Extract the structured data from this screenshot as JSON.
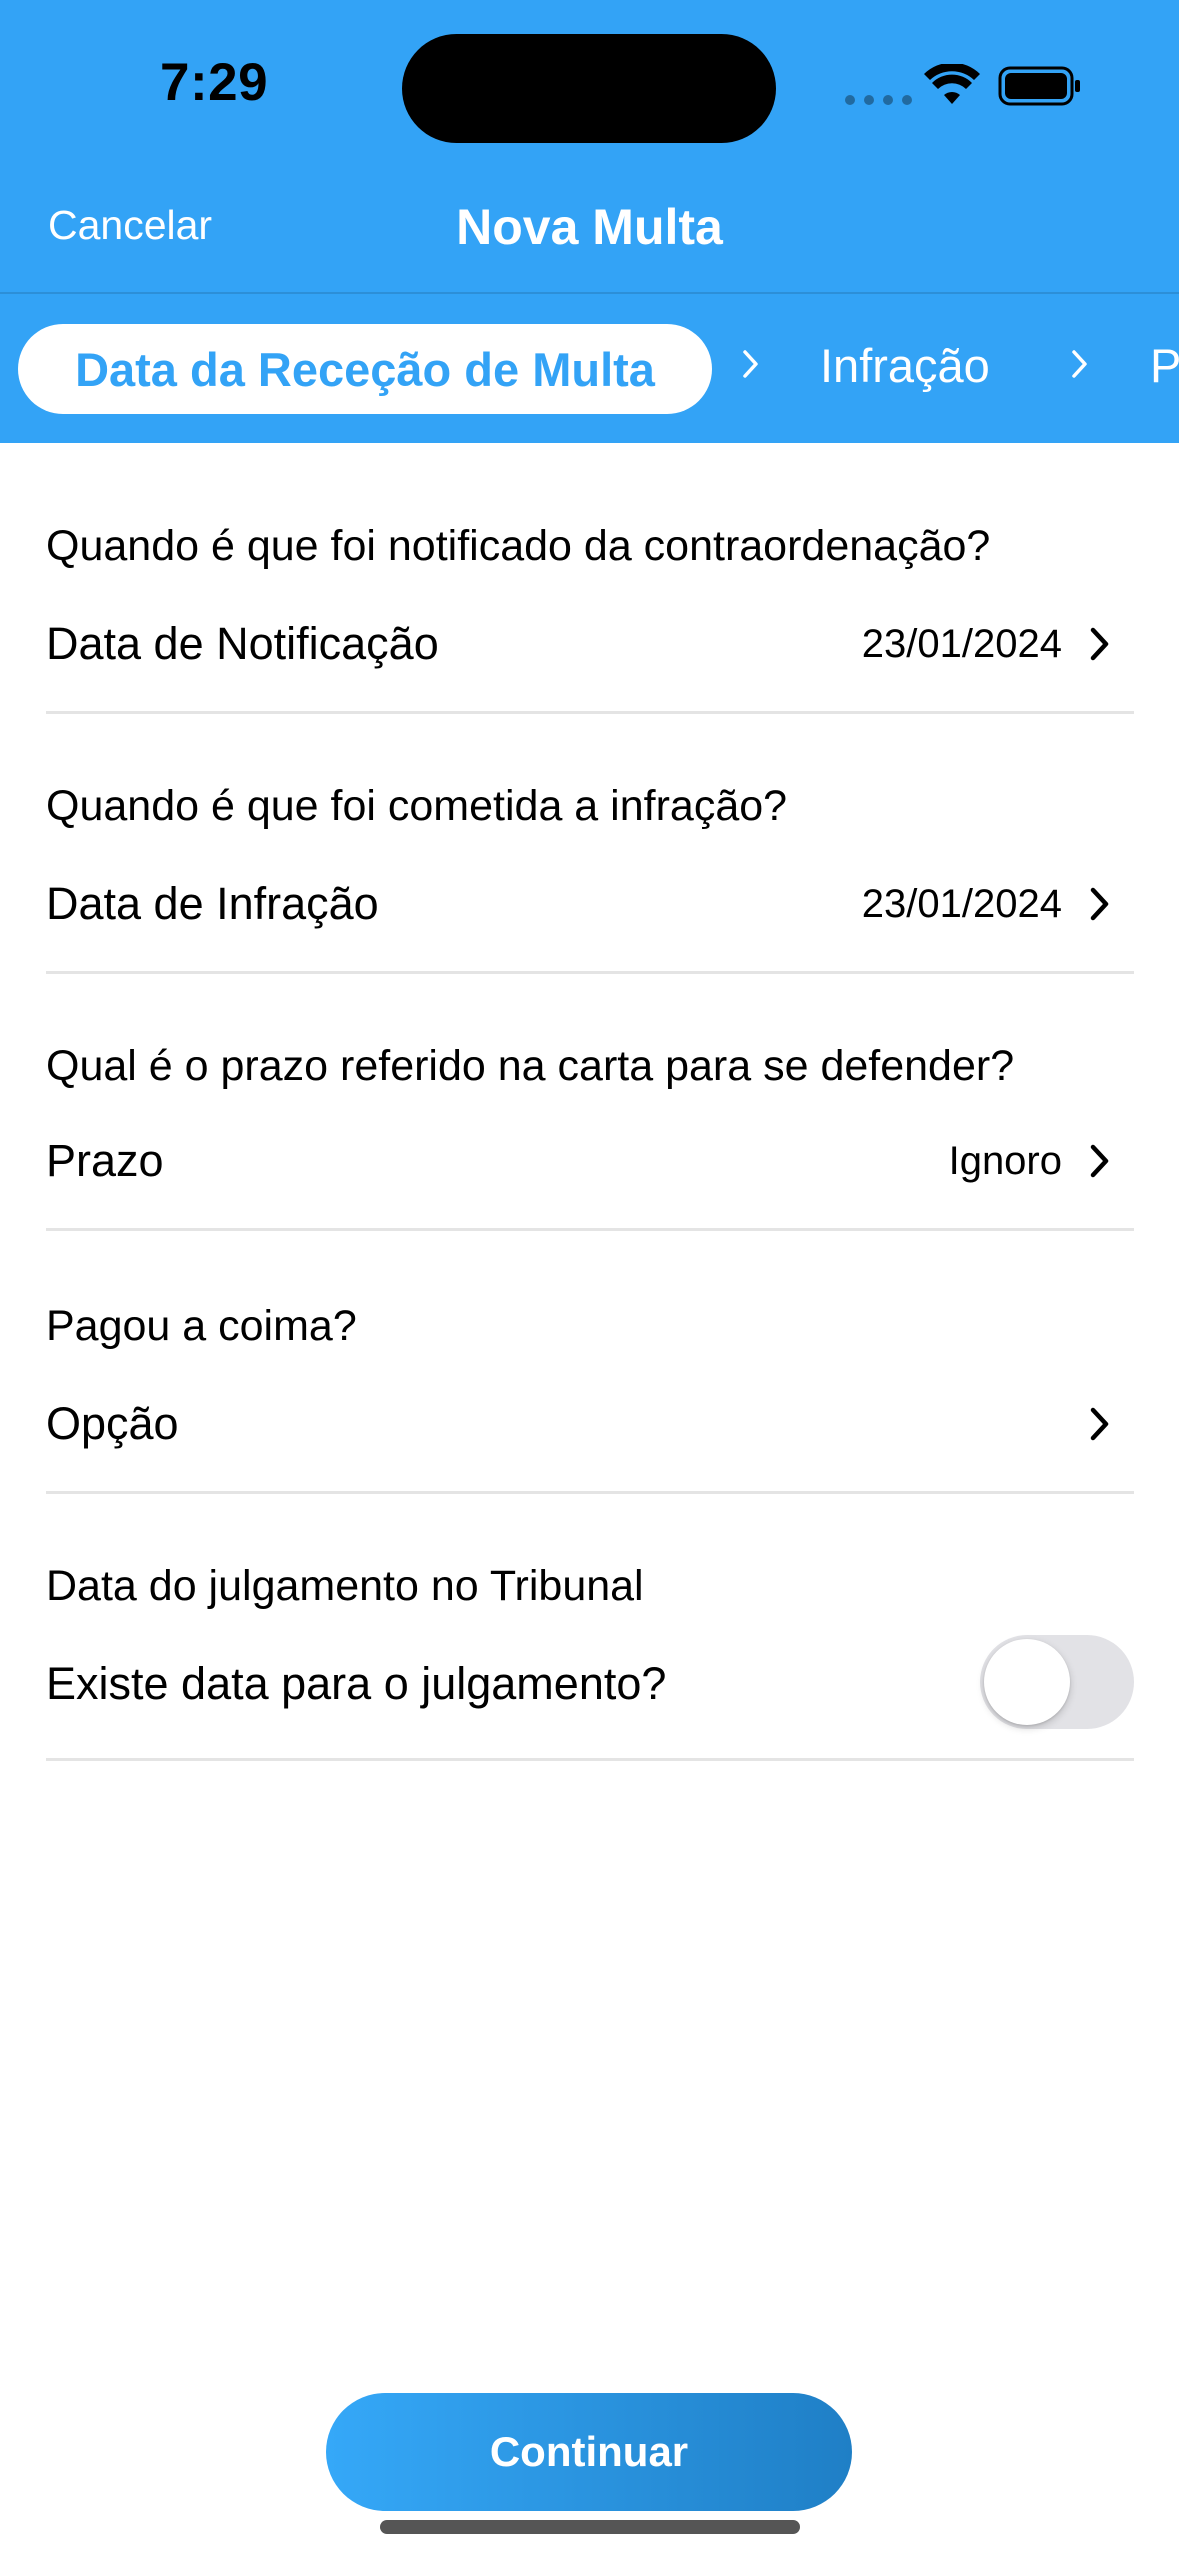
{
  "status_bar": {
    "time": "7:29",
    "icons": [
      "cellular-signal-icon",
      "wifi-icon",
      "battery-icon"
    ]
  },
  "nav": {
    "cancel_label": "Cancelar",
    "title": "Nova Multa"
  },
  "steps": {
    "active_label": "Data da Receção de Multa",
    "items": [
      "Infração",
      "Pa"
    ]
  },
  "form": {
    "notification": {
      "question": "Quando é que foi notificado da contraordenação?",
      "label": "Data de Notificação",
      "value": "23/01/2024"
    },
    "infraction": {
      "question": "Quando é que foi cometida a infração?",
      "label": "Data de Infração",
      "value": "23/01/2024"
    },
    "deadline": {
      "question": "Qual é o prazo referido na carta para se defender?",
      "label": "Prazo",
      "value": "Ignoro"
    },
    "payment": {
      "question": "Pagou a coima?",
      "label": "Opção",
      "value": ""
    },
    "trial": {
      "question": "Data do julgamento no Tribunal",
      "label": "Existe data para o julgamento?",
      "toggle_on": false
    }
  },
  "footer": {
    "continue_label": "Continuar"
  },
  "colors": {
    "accent": "#33A3F6",
    "button_gradient_end": "#1F7FC6"
  }
}
